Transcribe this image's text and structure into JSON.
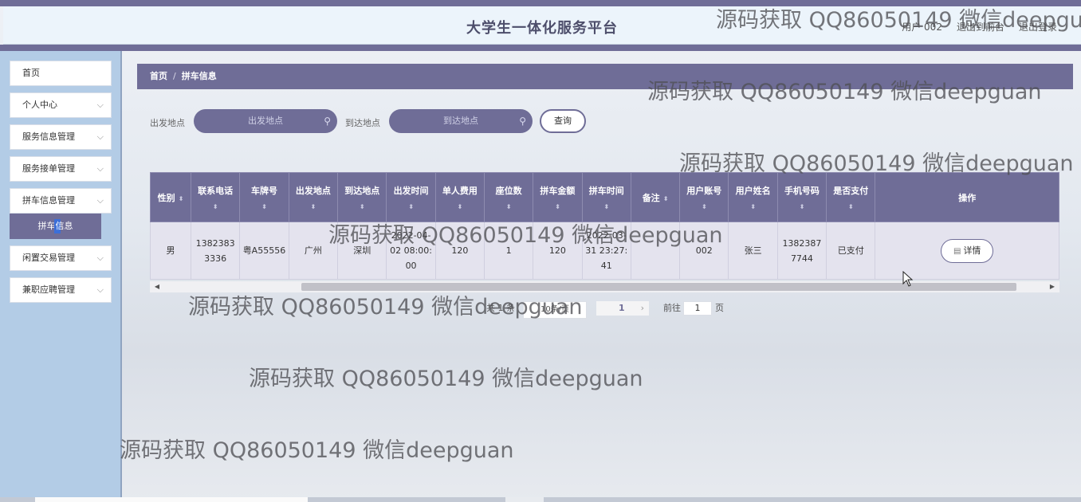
{
  "header": {
    "site_title": "大学生一体化服务平台",
    "user_label": "用户 002",
    "back_to_front": "退出到前台",
    "logout": "退出登录"
  },
  "sidebar": {
    "items": [
      {
        "label": "首页",
        "has_arrow": false
      },
      {
        "label": "个人中心",
        "has_arrow": true
      },
      {
        "label": "服务信息管理",
        "has_arrow": true
      },
      {
        "label": "服务接单管理",
        "has_arrow": true
      },
      {
        "label": "拼车信息管理",
        "has_arrow": true
      },
      {
        "label": "闲置交易管理",
        "has_arrow": true
      },
      {
        "label": "兼职应聘管理",
        "has_arrow": true
      }
    ],
    "active_sub": "拼车信息"
  },
  "breadcrumb": {
    "home": "首页",
    "separator": "/",
    "current": "拼车信息"
  },
  "filters": {
    "from_label": "出发地点",
    "from_placeholder": "出发地点",
    "to_label": "到达地点",
    "to_placeholder": "到达地点",
    "query_button": "查询"
  },
  "table": {
    "columns": [
      "性别",
      "联系电话",
      "车牌号",
      "出发地点",
      "到达地点",
      "出发时间",
      "单人费用",
      "座位数",
      "拼车金额",
      "拼车时间",
      "备注",
      "用户账号",
      "用户姓名",
      "手机号码",
      "是否支付",
      "操作"
    ],
    "rows": [
      {
        "gender": "男",
        "phone": "13823833336",
        "plate": "粤A55556",
        "from": "广州",
        "to": "深圳",
        "depart_time": "2022-04-02 08:00:00",
        "fee": "120",
        "seats": "1",
        "amount": "120",
        "carpool_time": "2022-03-31 23:27:41",
        "remark": "",
        "account": "002",
        "name": "张三",
        "mobile": "13823877744",
        "paid": "已支付",
        "action": "详情"
      }
    ]
  },
  "pagination": {
    "total_text": "共 1 条",
    "page_size": "10条/页",
    "current_page": "1",
    "goto_prefix": "前往",
    "goto_value": "1",
    "goto_suffix": "页"
  },
  "watermark_text": "源码获取 QQ86050149 微信deepguan",
  "colors": {
    "primary": "#6f6d97",
    "sidebar_bg": "#b3cce6",
    "header_bg": "#ecf4fb"
  }
}
